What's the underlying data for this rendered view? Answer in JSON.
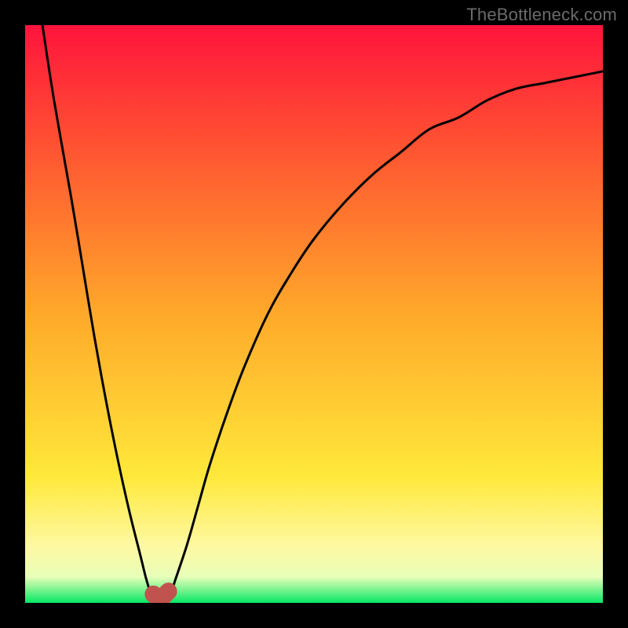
{
  "watermark": "TheBottleneck.com",
  "colors": {
    "frame": "#000000",
    "gradient_top": "#ff143c",
    "gradient_upper": "#ff4a33",
    "gradient_mid": "#ffa92a",
    "gradient_low": "#ffe83a",
    "gradient_soft": "#fff8a0",
    "gradient_pale": "#e8ffb9",
    "gradient_bottom": "#06e765",
    "curve": "#000000",
    "marker": "#c1534e"
  },
  "chart_data": {
    "type": "line",
    "title": "",
    "xlabel": "",
    "ylabel": "",
    "xlim": [
      0,
      100
    ],
    "ylim": [
      0,
      100
    ],
    "grid": false,
    "legend": false,
    "series": [
      {
        "name": "bottleneck-curve",
        "x": [
          3,
          5,
          8,
          10,
          12,
          14,
          16,
          18,
          20,
          21,
          22,
          23,
          24,
          25,
          26,
          28,
          30,
          32,
          35,
          38,
          42,
          46,
          50,
          55,
          60,
          65,
          70,
          75,
          80,
          85,
          90,
          95,
          100
        ],
        "y": [
          100,
          87,
          70,
          58,
          46,
          35,
          25,
          16,
          8,
          4,
          1,
          0,
          0,
          1,
          4,
          10,
          17,
          24,
          33,
          41,
          50,
          57,
          63,
          69,
          74,
          78,
          82,
          84,
          87,
          89,
          90,
          91,
          92
        ]
      }
    ],
    "markers": [
      {
        "name": "min-left",
        "x": 22.2,
        "y": 1.5
      },
      {
        "name": "min-mid",
        "x": 23.3,
        "y": 0.5
      },
      {
        "name": "min-right",
        "x": 24.8,
        "y": 2.0
      }
    ]
  }
}
